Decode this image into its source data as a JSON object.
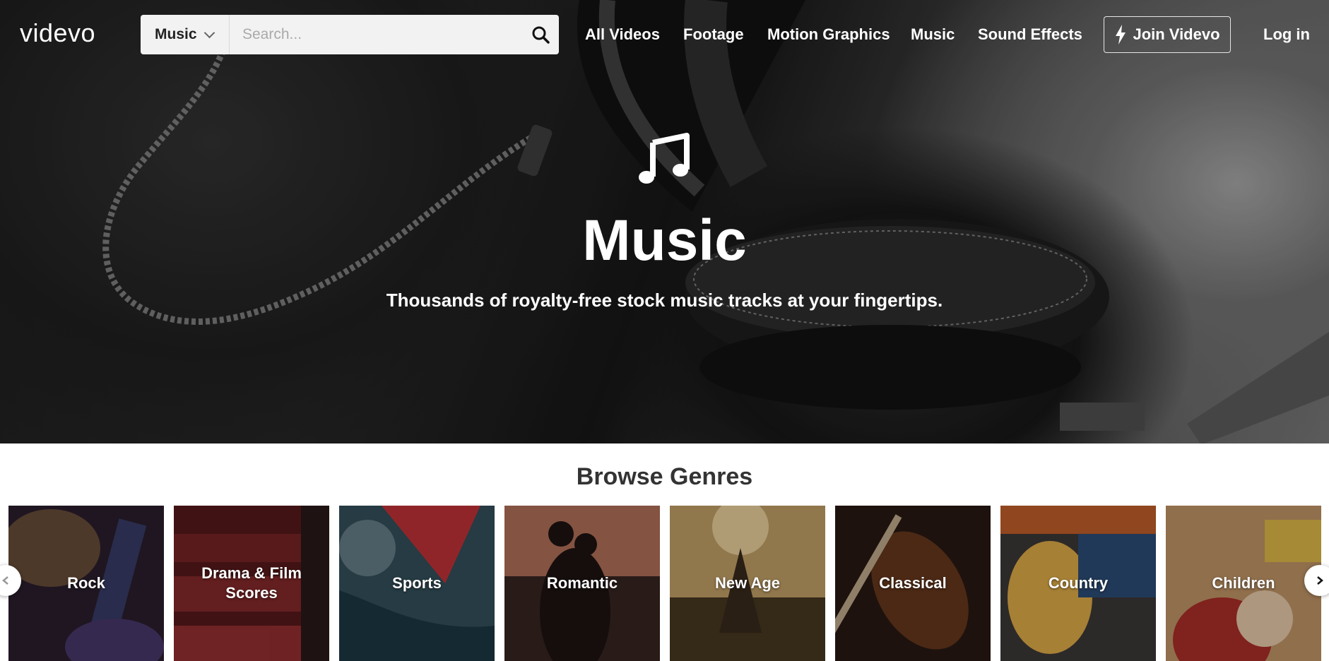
{
  "nav": {
    "logo": "videvo",
    "search_category": "Music",
    "search_placeholder": "Search...",
    "links": [
      "All Videos",
      "Footage",
      "Motion Graphics",
      "Music",
      "Sound Effects"
    ],
    "join_label": "Join Videvo",
    "login_label": "Log in"
  },
  "hero": {
    "icon": "music-note-icon",
    "title": "Music",
    "subtitle": "Thousands of royalty-free stock music tracks at your fingertips."
  },
  "genres": {
    "heading": "Browse Genres",
    "items": [
      {
        "label": "Rock",
        "color": "#2b1f2e"
      },
      {
        "label": "Drama & Film Scores",
        "color": "#5a1a1c"
      },
      {
        "label": "Sports",
        "color": "#35525e"
      },
      {
        "label": "Romantic",
        "color": "#4a2f2a"
      },
      {
        "label": "New Age",
        "color": "#6b5a3a"
      },
      {
        "label": "Classical",
        "color": "#2a1a14"
      },
      {
        "label": "Country",
        "color": "#3d3a3a"
      },
      {
        "label": "Children",
        "color": "#8a6a52"
      }
    ]
  },
  "colors": {
    "search_bg": "#f2f2f2",
    "heading_text": "#333333"
  }
}
